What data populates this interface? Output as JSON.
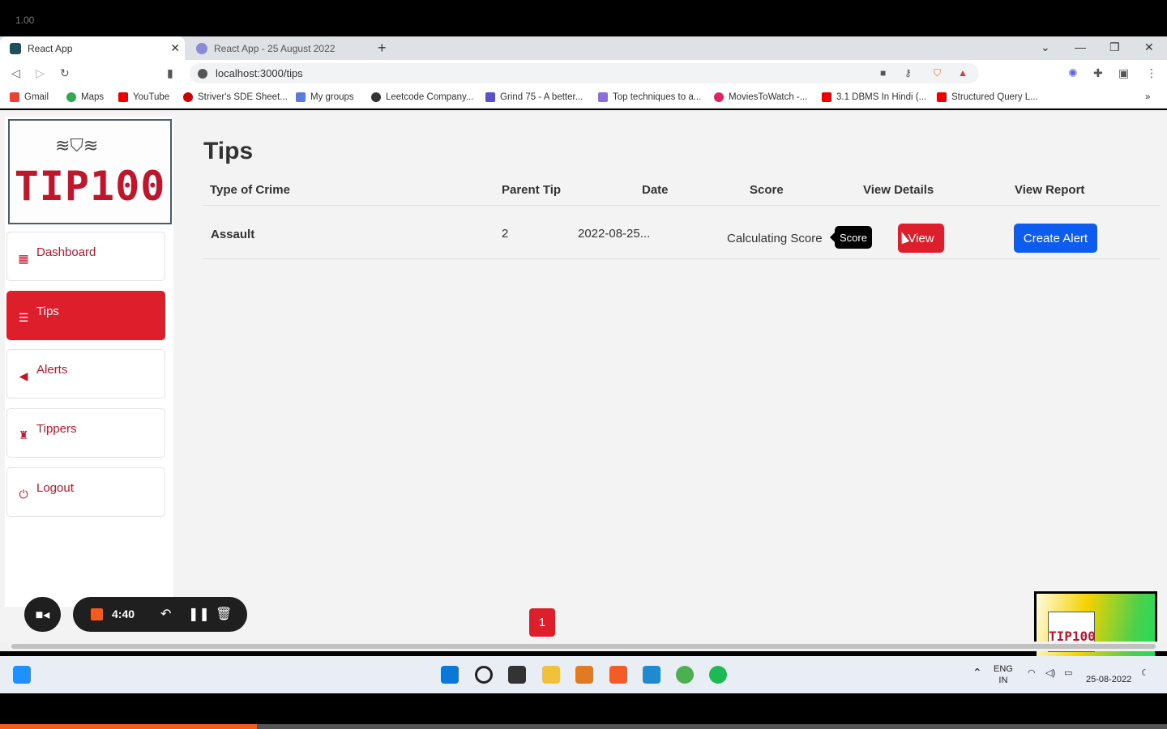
{
  "player": {
    "zoom_label": "1.00",
    "recording_time": "4:40",
    "progress_fraction": 0.22
  },
  "browser": {
    "tabs": [
      {
        "label": "React App"
      },
      {
        "label": "React App - 25 August 2022"
      }
    ],
    "url": "localhost:3000/tips",
    "bookmarks": [
      "Gmail",
      "Maps",
      "YouTube",
      "Striver's SDE Sheet...",
      "My groups",
      "Leetcode Company...",
      "Grind 75 - A better...",
      "Top techniques to a...",
      "MoviesToWatch -...",
      "3.1 DBMS In Hindi (...",
      "Structured Query L..."
    ]
  },
  "app": {
    "logo_text": "TIP100",
    "nav": [
      {
        "label": "Dashboard",
        "icon": "grid-icon"
      },
      {
        "label": "Tips",
        "icon": "list-icon"
      },
      {
        "label": "Alerts",
        "icon": "megaphone-icon"
      },
      {
        "label": "Tippers",
        "icon": "user-secret-icon"
      },
      {
        "label": "Logout",
        "icon": "power-icon"
      }
    ],
    "active_nav": "Tips",
    "page_title": "Tips",
    "table": {
      "headers": [
        "Type of Crime",
        "Parent Tip",
        "Date",
        "Score",
        "View Details",
        "View Report"
      ],
      "rows": [
        {
          "type": "Assault",
          "parent_tip": "2",
          "date": "2022-08-25...",
          "score": "Calculating Score",
          "tooltip": "Score",
          "view_label": "View",
          "report_label": "Create Alert"
        }
      ]
    },
    "pagination": {
      "current": "1"
    },
    "colors": {
      "primary_red": "#dc1f2a",
      "primary_blue": "#0d5cf0"
    }
  },
  "thumbnail": {
    "logo_text": "TIP100"
  },
  "taskbar": {
    "lang_line1": "ENG",
    "lang_line2": "IN",
    "date": "25-08-2022"
  }
}
